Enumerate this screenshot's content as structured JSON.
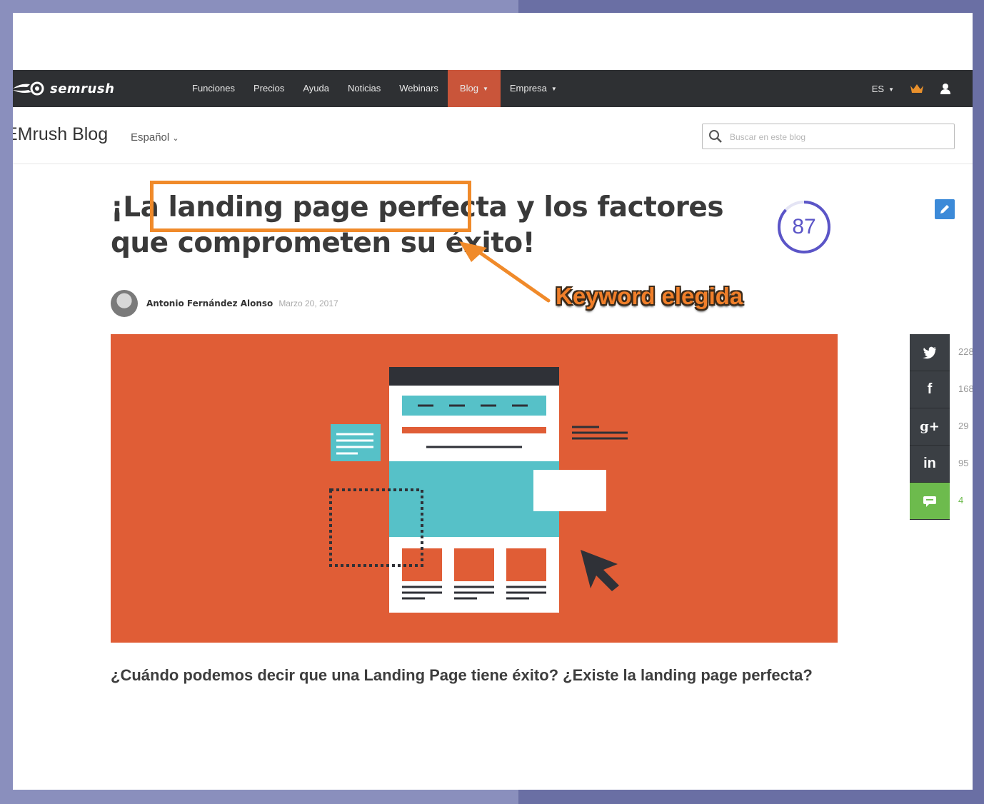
{
  "brand": {
    "logo_text": "semrush"
  },
  "nav": {
    "items": [
      {
        "label": "Funciones"
      },
      {
        "label": "Precios"
      },
      {
        "label": "Ayuda"
      },
      {
        "label": "Noticias"
      },
      {
        "label": "Webinars"
      },
      {
        "label": "Blog",
        "active": true
      },
      {
        "label": "Empresa"
      }
    ],
    "lang": "ES",
    "accent_color": "#c9553a"
  },
  "blog": {
    "title": "EMrush Blog",
    "language": "Español",
    "search_placeholder": "Buscar en este blog"
  },
  "article": {
    "title": "¡La landing page perfecta y los factores que comprometen su éxito!",
    "score": "87",
    "author": "Antonio Fernández Alonso",
    "date": "Marzo 20, 2017",
    "lead": "¿Cuándo podemos decir que una Landing Page tiene éxito? ¿Existe la landing page perfecta?"
  },
  "annotation": {
    "label": "Keyword elegida",
    "color": "#f08a2a"
  },
  "share": [
    {
      "icon": "twitter-icon",
      "glyph": "t",
      "count": "228"
    },
    {
      "icon": "facebook-icon",
      "glyph": "f",
      "count": "168"
    },
    {
      "icon": "google-plus-icon",
      "glyph": "g+",
      "count": "29"
    },
    {
      "icon": "linkedin-icon",
      "glyph": "in",
      "count": "95"
    },
    {
      "icon": "comment-icon",
      "glyph": "",
      "count": "4"
    }
  ]
}
